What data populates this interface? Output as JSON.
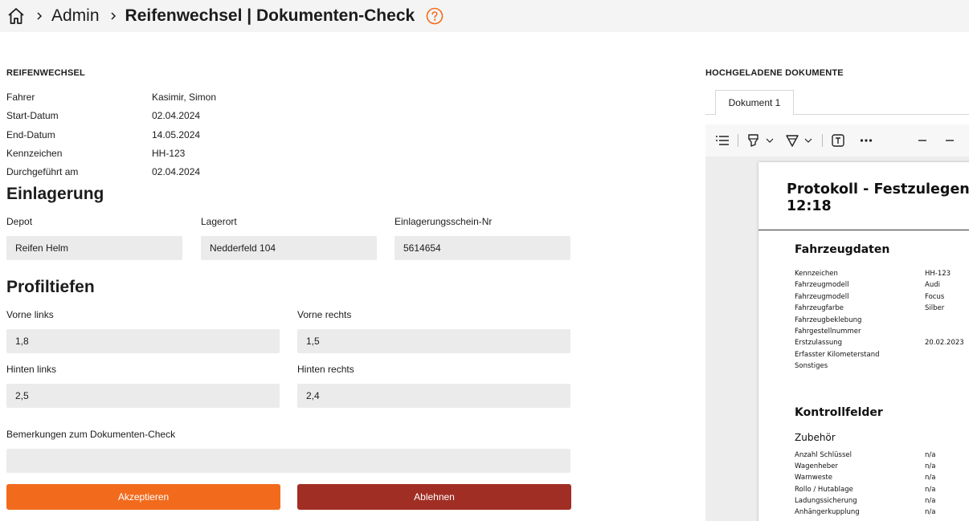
{
  "header": {
    "breadcrumb": [
      "Admin",
      "Reifenwechsel | Dokumenten-Check"
    ]
  },
  "details": {
    "section_title": "REIFENWECHSEL",
    "rows": [
      {
        "label": "Fahrer",
        "value": "Kasimir, Simon"
      },
      {
        "label": "Start-Datum",
        "value": "02.04.2024"
      },
      {
        "label": "End-Datum",
        "value": "14.05.2024"
      },
      {
        "label": "Kennzeichen",
        "value": "HH-123"
      },
      {
        "label": "Durchgeführt am",
        "value": "02.04.2024"
      }
    ]
  },
  "einlagerung": {
    "title": "Einlagerung",
    "depot": {
      "label": "Depot",
      "value": "Reifen Helm"
    },
    "lagerort": {
      "label": "Lagerort",
      "value": "Nedderfeld 104"
    },
    "schein": {
      "label": "Einlagerungsschein-Nr",
      "value": "5614654"
    }
  },
  "profiltiefen": {
    "title": "Profiltiefen",
    "vorne_links": {
      "label": "Vorne links",
      "value": "1,8"
    },
    "vorne_rechts": {
      "label": "Vorne rechts",
      "value": "1,5"
    },
    "hinten_links": {
      "label": "Hinten links",
      "value": "2,5"
    },
    "hinten_rechts": {
      "label": "Hinten rechts",
      "value": "2,4"
    }
  },
  "remarks": {
    "label": "Bemerkungen zum Dokumenten-Check",
    "value": ""
  },
  "actions": {
    "accept": "Akzeptieren",
    "reject": "Ablehnen"
  },
  "documents": {
    "section_title": "HOCHGELADENE DOKUMENTE",
    "tab": "Dokument 1",
    "toolbar_icons": [
      "list-icon",
      "highlighter-icon",
      "pen-icon",
      "text-box-icon",
      "more-icon",
      "zoom-out-icon"
    ],
    "pdf": {
      "title": "Protokoll - Festzulegen\n12:18",
      "fahrzeugdaten": {
        "heading": "Fahrzeugdaten",
        "rows": [
          {
            "label": "Kennzeichen",
            "value": "HH-123"
          },
          {
            "label": "Fahrzeugmodell",
            "value": "Audi"
          },
          {
            "label": "Fahrzeugmodell",
            "value": "Focus"
          },
          {
            "label": "Fahrzeugfarbe",
            "value": "Silber"
          },
          {
            "label": "Fahrzeugbeklebung",
            "value": ""
          },
          {
            "label": "Fahrgestellnummer",
            "value": ""
          },
          {
            "label": "Erstzulassung",
            "value": "20.02.2023"
          },
          {
            "label": "Erfasster Kilometerstand",
            "value": ""
          },
          {
            "label": "Sonstiges",
            "value": ""
          }
        ]
      },
      "kontrollfelder": {
        "heading": "Kontrollfelder",
        "subheading": "Zubehör",
        "rows": [
          {
            "label": "Anzahl Schlüssel",
            "value": "n/a"
          },
          {
            "label": "Wagenheber",
            "value": "n/a"
          },
          {
            "label": "Warnweste",
            "value": "n/a"
          },
          {
            "label": "Rollo / Hutablage",
            "value": "n/a"
          },
          {
            "label": "Ladungssicherung",
            "value": "n/a"
          },
          {
            "label": "Anhängerkupplung",
            "value": "n/a"
          }
        ]
      }
    }
  },
  "colors": {
    "accent": "#f26b1d",
    "reject": "#a12e24",
    "field_bg": "#ebebeb",
    "header_bg": "#f4f4f4"
  }
}
